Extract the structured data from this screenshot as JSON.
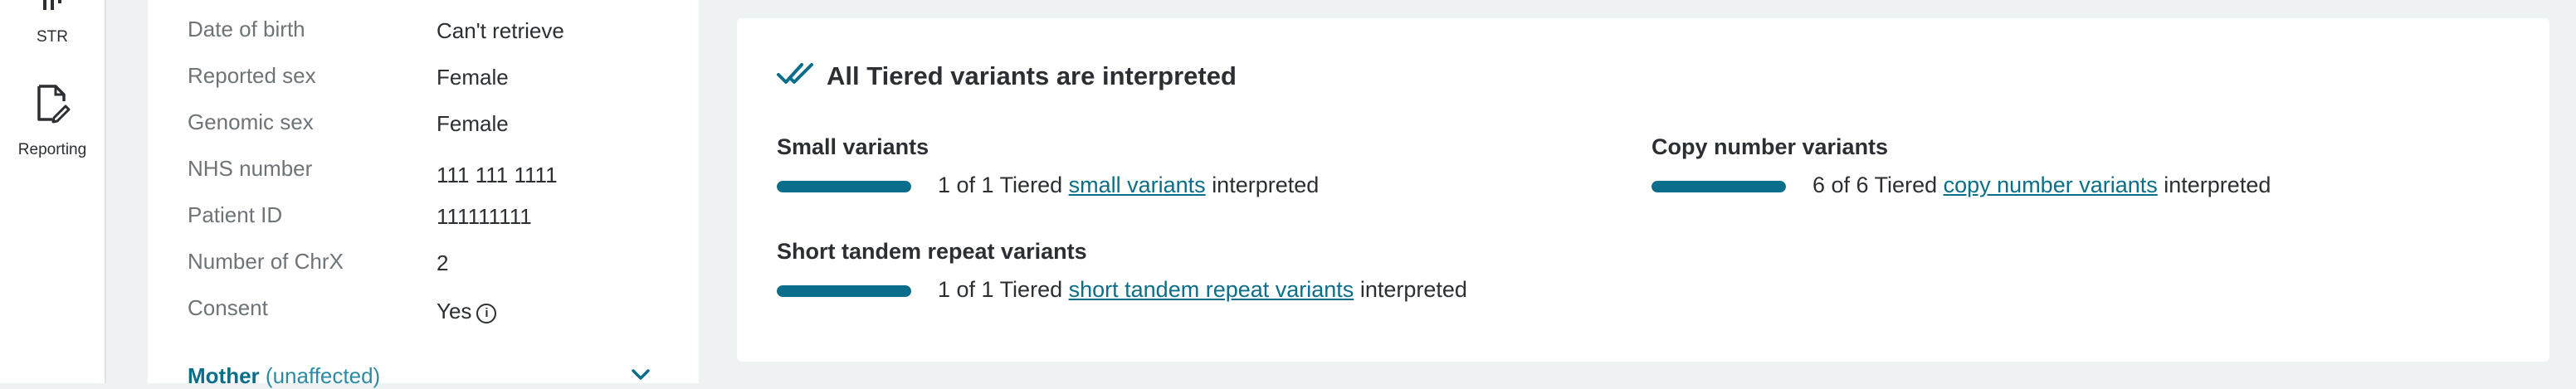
{
  "nav": {
    "items": [
      {
        "label": "STR",
        "icon": "bar-chart-icon"
      },
      {
        "label": "Reporting",
        "icon": "document-edit-icon"
      }
    ]
  },
  "patient": {
    "fields": [
      {
        "label": "Date of birth",
        "value": "Can't retrieve"
      },
      {
        "label": "Reported sex",
        "value": "Female"
      },
      {
        "label": "Genomic sex",
        "value": "Female"
      },
      {
        "label": "NHS number",
        "value": "111 111 1111"
      },
      {
        "label": "Patient ID",
        "value": "111111111"
      },
      {
        "label": "Number of ChrX",
        "value": "2"
      },
      {
        "label": "Consent",
        "value": "Yes"
      }
    ],
    "relative": {
      "name": "Mother",
      "status": "(unaffected)"
    }
  },
  "interpretation": {
    "title": "All Tiered variants are interpreted",
    "groups": [
      {
        "heading": "Small variants",
        "count_text": "1 of 1 Tiered",
        "link": "small variants",
        "suffix": "interpreted",
        "progress": 1.0
      },
      {
        "heading": "Copy number variants",
        "count_text": "6 of 6 Tiered",
        "link": "copy number variants",
        "suffix": "interpreted",
        "progress": 1.0
      },
      {
        "heading": "Short tandem repeat variants",
        "count_text": "1 of 1 Tiered",
        "link": "short tandem repeat variants",
        "suffix": "interpreted",
        "progress": 1.0
      }
    ]
  },
  "colors": {
    "accent": "#0a6e8a",
    "muted_label": "#6d7377",
    "background": "#eef2f3"
  }
}
